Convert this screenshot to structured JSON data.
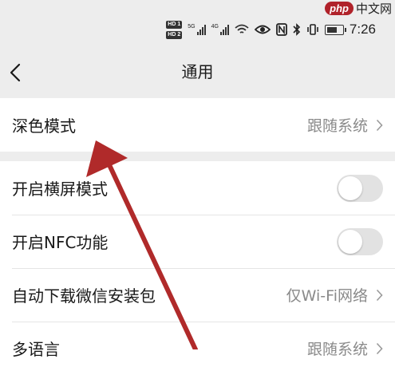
{
  "status_bar": {
    "hd_badges": [
      "HD 1",
      "HD 2"
    ],
    "signal_labels": [
      "5G",
      "4G"
    ],
    "time": "7:26",
    "icons": [
      "eye-icon",
      "nfc-icon",
      "bluetooth-icon",
      "vibrate-icon",
      "battery-icon",
      "wifi-icon"
    ]
  },
  "watermark": {
    "logo": "php",
    "text": "中文网"
  },
  "header": {
    "title": "通用",
    "back_icon": "chevron-left-icon"
  },
  "group1": {
    "items": [
      {
        "label": "深色模式",
        "value": "跟随系统"
      }
    ]
  },
  "group2": {
    "items": [
      {
        "label": "开启横屏模式",
        "toggle_on": false
      },
      {
        "label": "开启NFC功能",
        "toggle_on": false
      },
      {
        "label": "自动下载微信安装包",
        "value": "仅Wi-Fi网络"
      },
      {
        "label": "多语言",
        "value": "跟随系统"
      }
    ]
  },
  "annotation": {
    "arrow_color": "#b02a2a"
  },
  "colors": {
    "background": "#ededed",
    "card": "#ffffff",
    "secondary_text": "#8a8a8a",
    "toggle_off": "#e2e2e2"
  }
}
